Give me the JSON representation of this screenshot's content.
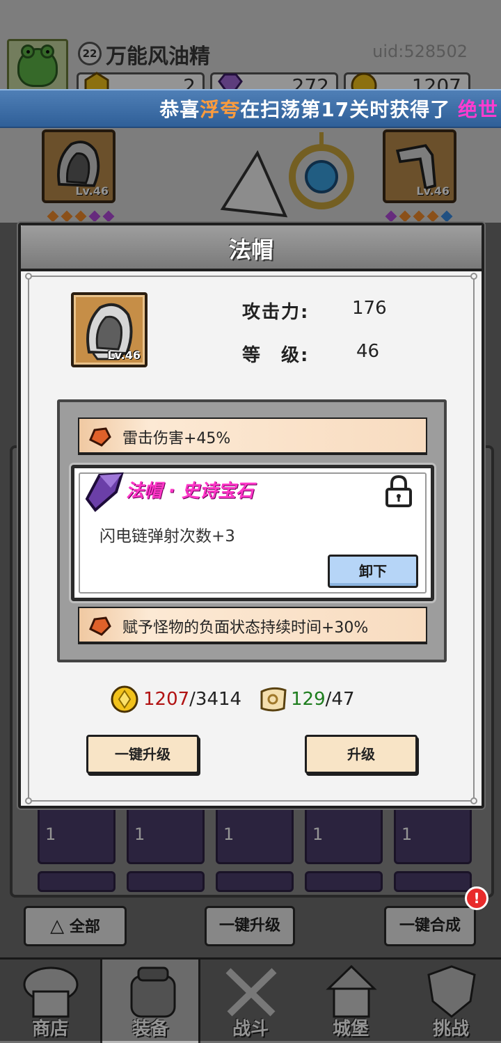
{
  "player": {
    "level": "22",
    "name": "万能风油精",
    "uid": "uid:528502",
    "resource_gem_a": "2",
    "resource_gem_b": "272",
    "resource_gold": "1207"
  },
  "announcement": {
    "prefix": "恭喜",
    "player_name": "浮夸",
    "middle": "在扫荡第17关时获得了",
    "rarity": "绝世"
  },
  "equip_slots": [
    {
      "level_label": "Lv.46"
    },
    {
      "level_label": "Lv.46"
    }
  ],
  "modal": {
    "title": "法帽",
    "item_level_label": "Lv.46",
    "stats": [
      {
        "label": "攻击力:",
        "value": "176"
      },
      {
        "label": "等　级:",
        "value": "46"
      }
    ],
    "affixes": [
      {
        "text": "雷击伤害+45%"
      },
      {
        "text": "赋予怪物的负面状态持续时间+30%"
      }
    ],
    "gem": {
      "title": "法帽 · 史诗宝石",
      "description": "闪电链弹射次数+3",
      "unequip_label": "卸下"
    },
    "costs": {
      "gold_have": "1207",
      "gold_need": "/3414",
      "scroll_have": "129",
      "scroll_need": "/47"
    },
    "buttons": {
      "upgrade_all": "一键升级",
      "upgrade": "升级"
    }
  },
  "gem_grid": {
    "count_label": "1"
  },
  "bottom_bar": {
    "filter_label": "全部",
    "upgrade_all_label": "一键升级",
    "merge_all_label": "一键合成",
    "alert": "!"
  },
  "nav": [
    {
      "label": "商店"
    },
    {
      "label": "装备"
    },
    {
      "label": "战斗"
    },
    {
      "label": "城堡"
    },
    {
      "label": "挑战"
    }
  ],
  "colors": {
    "gem_title": "#ff36c8",
    "cost_insufficient": "#b11212",
    "cost_sufficient": "#1e7d1e",
    "unequip_button": "#b6d5f7",
    "action_button": "#f8e4c6"
  }
}
